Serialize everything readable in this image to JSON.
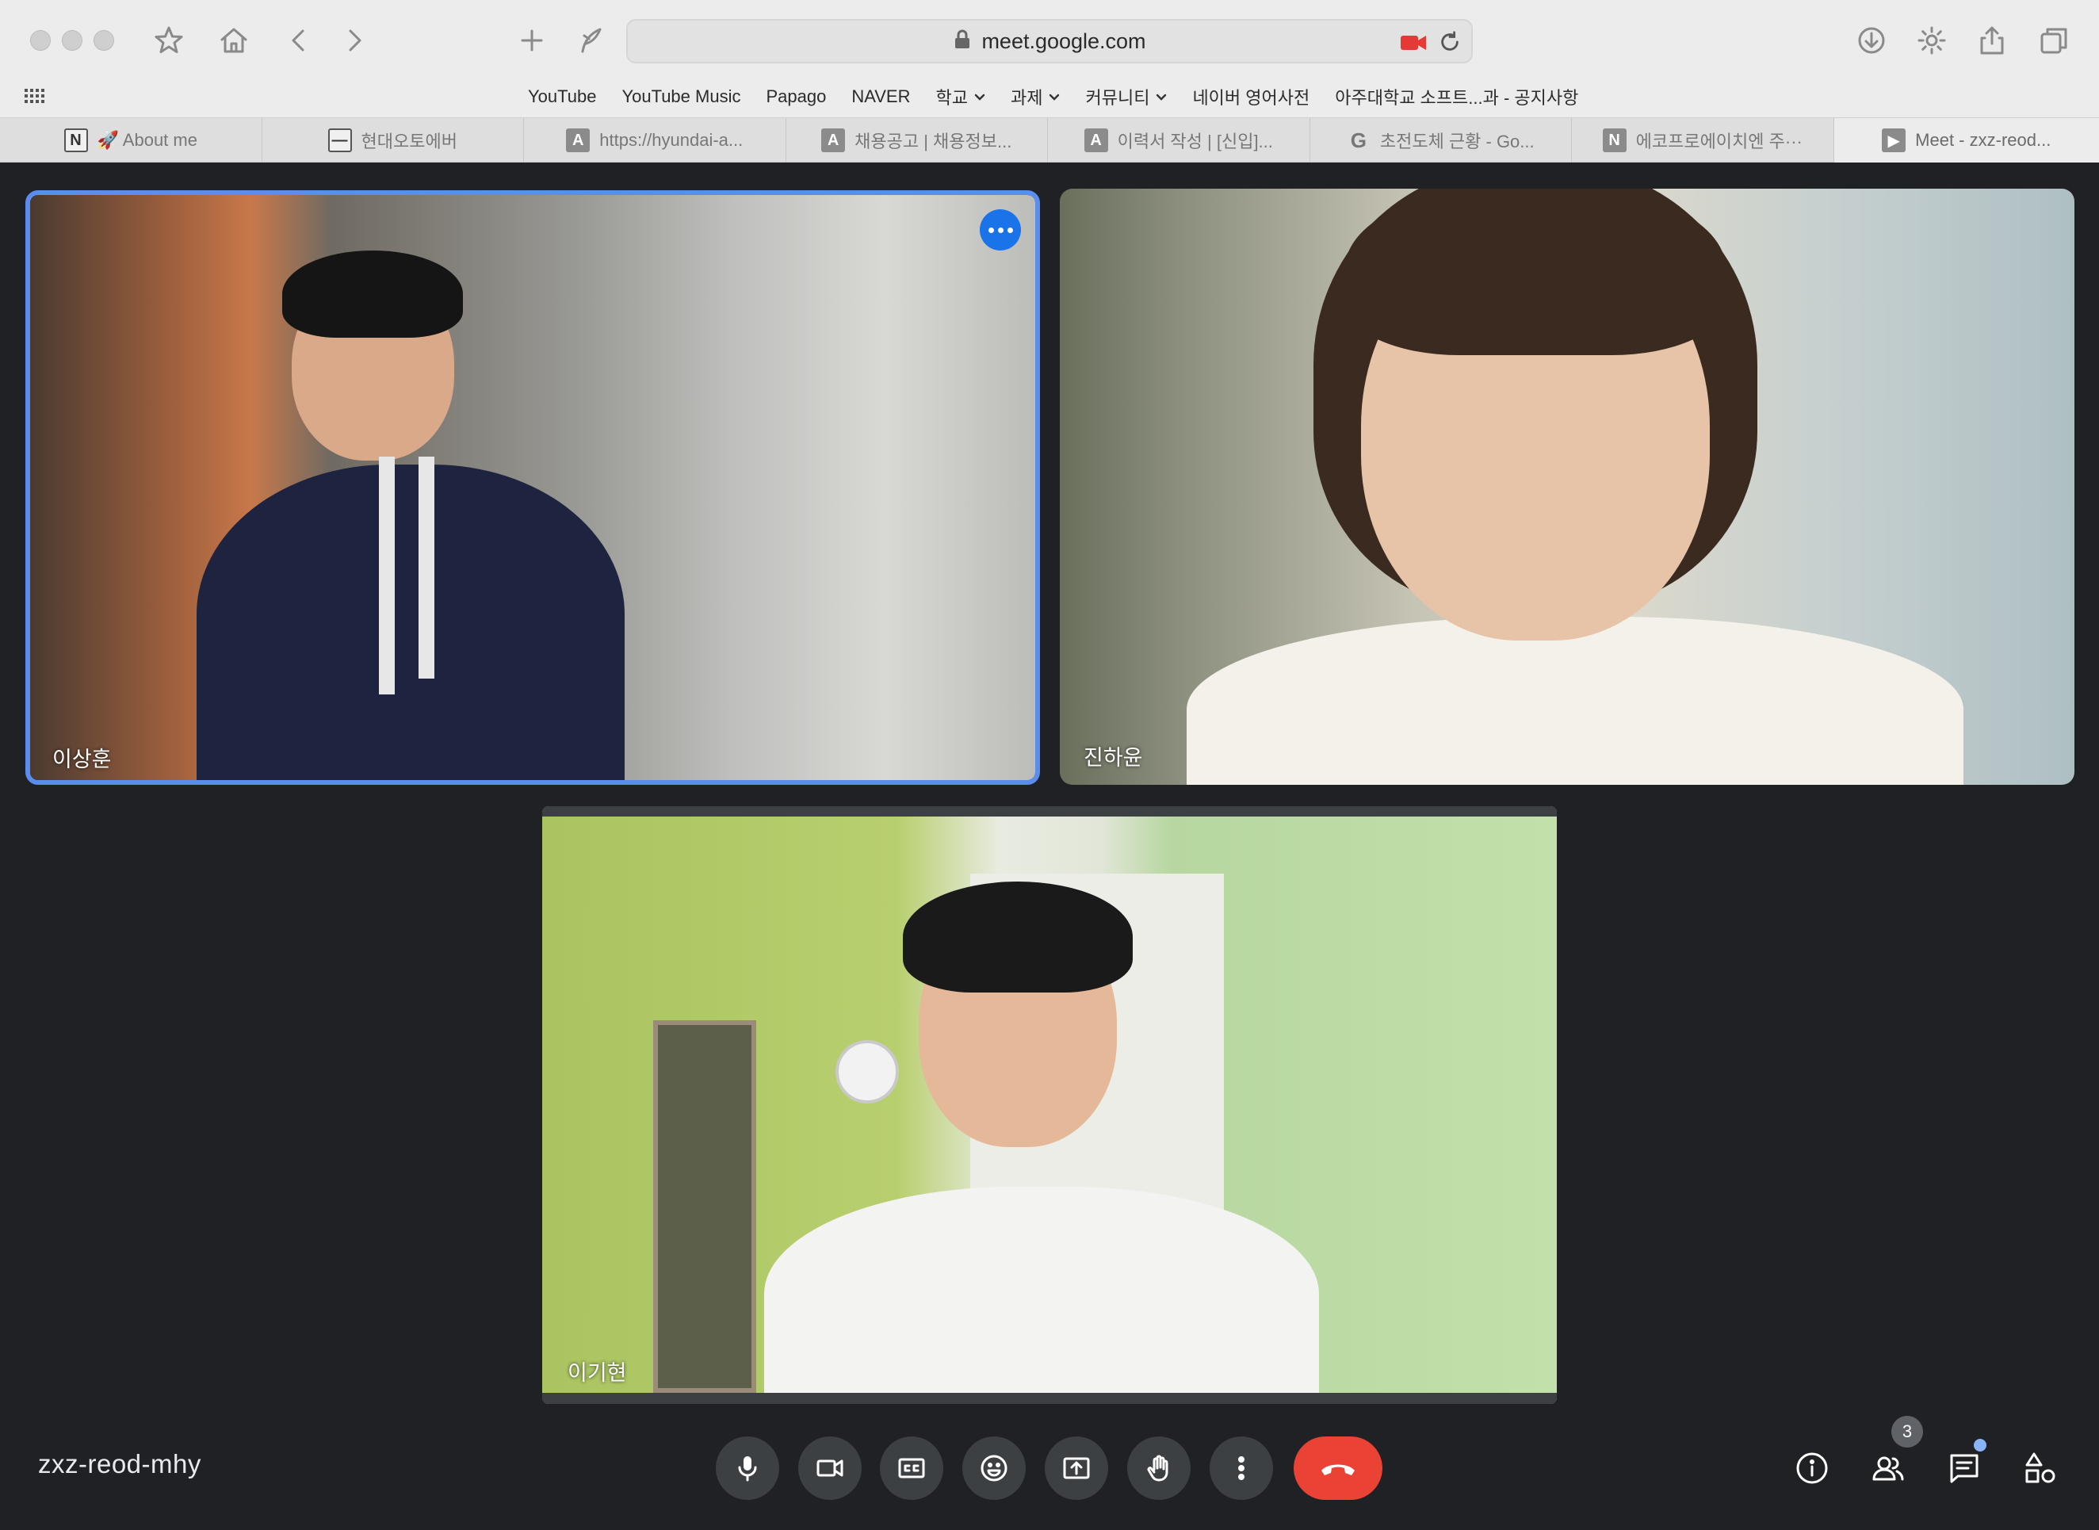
{
  "browser": {
    "url": "meet.google.com",
    "bookmarks": [
      {
        "label": "YouTube",
        "dropdown": false
      },
      {
        "label": "YouTube Music",
        "dropdown": false
      },
      {
        "label": "Papago",
        "dropdown": false
      },
      {
        "label": "NAVER",
        "dropdown": false
      },
      {
        "label": "학교",
        "dropdown": true
      },
      {
        "label": "과제",
        "dropdown": true
      },
      {
        "label": "커뮤니티",
        "dropdown": true
      },
      {
        "label": "네이버 영어사전",
        "dropdown": false
      },
      {
        "label": "아주대학교 소프트...과 - 공지사항",
        "dropdown": false
      }
    ],
    "tabs": [
      {
        "label": "🚀 About me",
        "favicon": "N",
        "favicon_style": "light"
      },
      {
        "label": "현대오토에버",
        "favicon": "—",
        "favicon_style": "light"
      },
      {
        "label": "https://hyundai-a...",
        "favicon": "A",
        "favicon_style": "dark"
      },
      {
        "label": "채용공고 | 채용정보...",
        "favicon": "A",
        "favicon_style": "dark"
      },
      {
        "label": "이력서 작성 | [신입]...",
        "favicon": "A",
        "favicon_style": "dark"
      },
      {
        "label": "초전도체 근황 - Go...",
        "favicon": "G",
        "favicon_style": "g"
      },
      {
        "label": "에코프로에이치엔 주···",
        "favicon": "N",
        "favicon_style": "dark"
      },
      {
        "label": "Meet - zxz-reod...",
        "favicon": "▶",
        "favicon_style": "dark",
        "active": true
      }
    ]
  },
  "meet": {
    "participants": [
      {
        "name": "이상훈",
        "active_speaker": true
      },
      {
        "name": "진하윤",
        "active_speaker": false
      },
      {
        "name": "이기현",
        "active_speaker": false
      }
    ],
    "meeting_code": "zxz-reod-mhy",
    "people_count": "3",
    "colors": {
      "accent": "#1a73e8",
      "hangup": "#ea4335",
      "background": "#202124",
      "control": "#3c4043"
    }
  }
}
